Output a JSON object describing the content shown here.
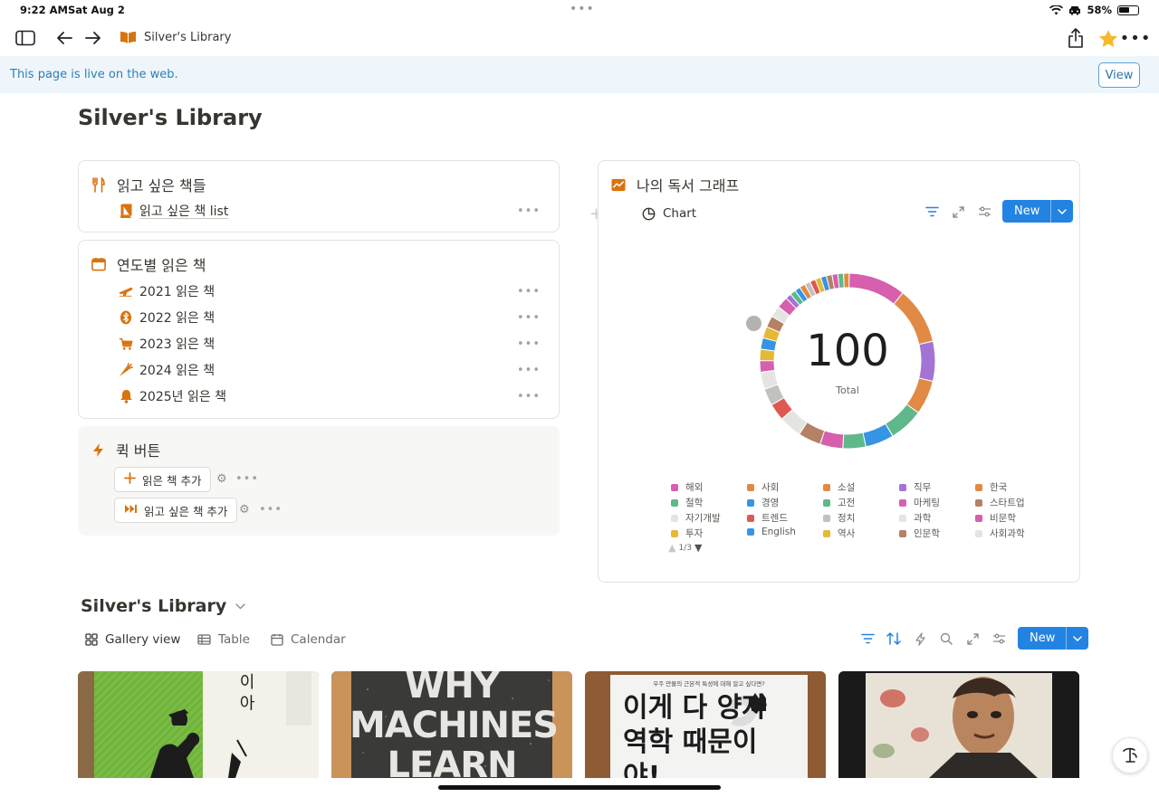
{
  "status_bar": {
    "time": "9:22 AM",
    "date": "Sat Aug 2",
    "battery": "58%",
    "battery_level": 0.58
  },
  "nav": {
    "breadcrumb": "Silver's Library",
    "page_icon": "book-icon"
  },
  "banner": {
    "text": "This page is live on the web.",
    "view_label": "View"
  },
  "page": {
    "title": "Silver's Library"
  },
  "want_to_read": {
    "title": "읽고 싶은 책들",
    "icon": "fork-knife-icon",
    "items": [
      {
        "label": "읽고 싶은 책 list",
        "icon": "book-icon"
      }
    ]
  },
  "by_year": {
    "title": "연도별 읽은 책",
    "icon": "calendar-icon",
    "items": [
      {
        "label": "2021 읽은 책",
        "icon": "airplane-icon"
      },
      {
        "label": "2022 읽은 책",
        "icon": "bluetooth-icon"
      },
      {
        "label": "2023 읽은 책",
        "icon": "cart-icon"
      },
      {
        "label": "2024 읽은 책",
        "icon": "carrot-icon"
      },
      {
        "label": "2025년 읽은 책",
        "icon": "bell-icon"
      }
    ]
  },
  "quick_buttons": {
    "title": "퀵 버튼",
    "icon": "lightning-icon",
    "buttons": [
      {
        "label": "읽은 책 추가",
        "icon": "plus-icon"
      },
      {
        "label": "읽고 싶은 책 추가",
        "icon": "fast-forward-icon"
      }
    ]
  },
  "reading_graph": {
    "title": "나의 독서 그래프",
    "icon": "chart-line-icon",
    "view_label": "Chart",
    "new_label": "New",
    "total_label": "Total",
    "pager": "1/3"
  },
  "chart_data": {
    "type": "pie",
    "total": 100,
    "legend": [
      {
        "name": "해외",
        "color": "#d65fae"
      },
      {
        "name": "사회",
        "color": "#e08a45"
      },
      {
        "name": "소설",
        "color": "#e08a45"
      },
      {
        "name": "직무",
        "color": "#a374d5"
      },
      {
        "name": "한국",
        "color": "#e08a45"
      },
      {
        "name": "철학",
        "color": "#5fb88a"
      },
      {
        "name": "경영",
        "color": "#3694e4"
      },
      {
        "name": "고전",
        "color": "#5fb88a"
      },
      {
        "name": "마케팅",
        "color": "#d65fae"
      },
      {
        "name": "스타트업",
        "color": "#b48164"
      },
      {
        "name": "자기개발",
        "color": "#e4e4e2"
      },
      {
        "name": "트렌드",
        "color": "#de5a4f"
      },
      {
        "name": "정치",
        "color": "#c2c1bd"
      },
      {
        "name": "과학",
        "color": "#e4e4e2"
      },
      {
        "name": "비문학",
        "color": "#d65fae"
      },
      {
        "name": "투자",
        "color": "#e5b836"
      },
      {
        "name": "English",
        "color": "#3694e4"
      },
      {
        "name": "역사",
        "color": "#e5b836"
      },
      {
        "name": "인문학",
        "color": "#b48164"
      },
      {
        "name": "사회과학",
        "color": "#e4e4e2"
      }
    ],
    "slices": [
      {
        "color": "#d65fae",
        "value": 10
      },
      {
        "color": "#e08a45",
        "value": 10
      },
      {
        "color": "#a374d5",
        "value": 7
      },
      {
        "color": "#e08a45",
        "value": 6
      },
      {
        "color": "#5fb88a",
        "value": 6
      },
      {
        "color": "#3694e4",
        "value": 5
      },
      {
        "color": "#5fb88a",
        "value": 4
      },
      {
        "color": "#d65fae",
        "value": 4
      },
      {
        "color": "#b48164",
        "value": 4
      },
      {
        "color": "#e4e4e2",
        "value": 4
      },
      {
        "color": "#de5a4f",
        "value": 3
      },
      {
        "color": "#c2c1bd",
        "value": 3
      },
      {
        "color": "#e4e4e2",
        "value": 3
      },
      {
        "color": "#d65fae",
        "value": 2
      },
      {
        "color": "#e5b836",
        "value": 2
      },
      {
        "color": "#3694e4",
        "value": 2
      },
      {
        "color": "#e5b836",
        "value": 2
      },
      {
        "color": "#b48164",
        "value": 2
      },
      {
        "color": "#e4e4e2",
        "value": 2
      },
      {
        "color": "#d65fae",
        "value": 2
      },
      {
        "color": "#a374d5",
        "value": 1
      },
      {
        "color": "#5fb88a",
        "value": 1
      },
      {
        "color": "#3694e4",
        "value": 1
      },
      {
        "color": "#e08a45",
        "value": 1
      },
      {
        "color": "#c2c1bd",
        "value": 1
      },
      {
        "color": "#de5a4f",
        "value": 1
      },
      {
        "color": "#e5b836",
        "value": 1
      },
      {
        "color": "#3694e4",
        "value": 1
      },
      {
        "color": "#b48164",
        "value": 1
      },
      {
        "color": "#d65fae",
        "value": 1
      },
      {
        "color": "#5fb88a",
        "value": 1
      },
      {
        "color": "#e08a45",
        "value": 1
      }
    ]
  },
  "database": {
    "title": "Silver's Library",
    "views": [
      "Gallery view",
      "Table",
      "Calendar"
    ],
    "new_label": "New",
    "cards": [
      {
        "title_text": "이 아",
        "art": "green-cover"
      },
      {
        "title_text": "WHY MACHINES LEARN",
        "art": "dark-cover"
      },
      {
        "title_text": "이게 다 양자역학 때문이야!",
        "subtitle": "우주 만물의 근본적 특성에 대해 알고 싶다면?",
        "art": "white-cover"
      },
      {
        "title_text": "",
        "art": "painting-cover"
      }
    ]
  },
  "accent_colors": {
    "brand_orange": "#d9730d",
    "blue": "#2383e2"
  }
}
